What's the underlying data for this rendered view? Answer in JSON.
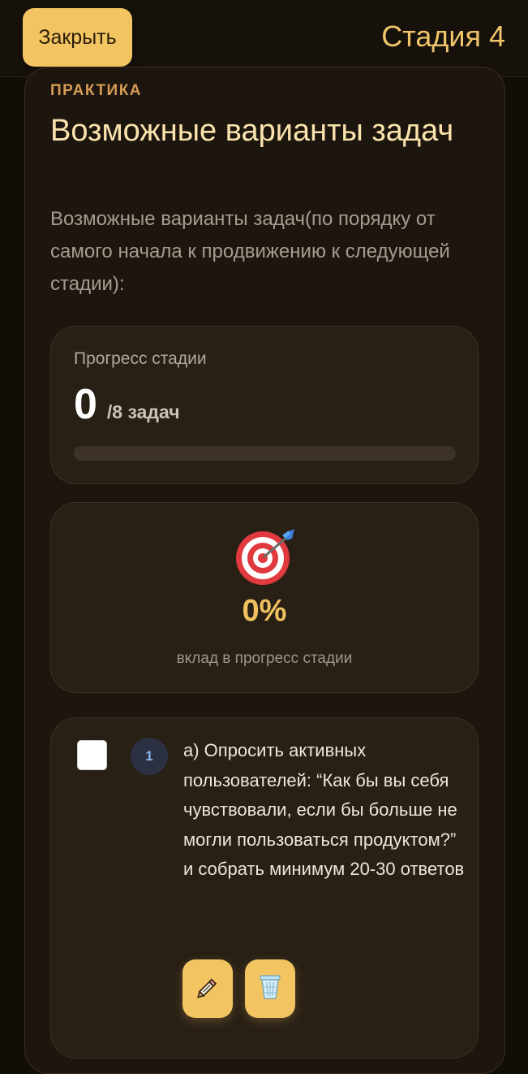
{
  "header": {
    "close_label": "Закрыть",
    "stage_title": "Стадия 4"
  },
  "section": {
    "label": "ПРАКТИКА",
    "title": "Возможные варианты задач",
    "description": "Возможные варианты задач(по порядку от самого начала к продвижению к следующей стадии):"
  },
  "progress": {
    "label": "Прогресс стадии",
    "done": "0",
    "total": "/8 задач",
    "fraction": 0
  },
  "contribution": {
    "icon": "target-dart-icon",
    "percent": "0%",
    "caption": "вклад в прогресс стадии"
  },
  "tasks": [
    {
      "number": "1",
      "checked": false,
      "text": "а) Опросить активных пользователей: “Как бы вы себя чувствовали, если бы больше не могли пользоваться продуктом?” и собрать минимум 20-30 ответов",
      "edit_icon": "pencil-icon",
      "delete_icon": "trash-can-icon"
    }
  ],
  "colors": {
    "accent": "#f2c462",
    "background": "#120d07",
    "title": "#fbe3ae",
    "section_label": "#d69b55"
  }
}
